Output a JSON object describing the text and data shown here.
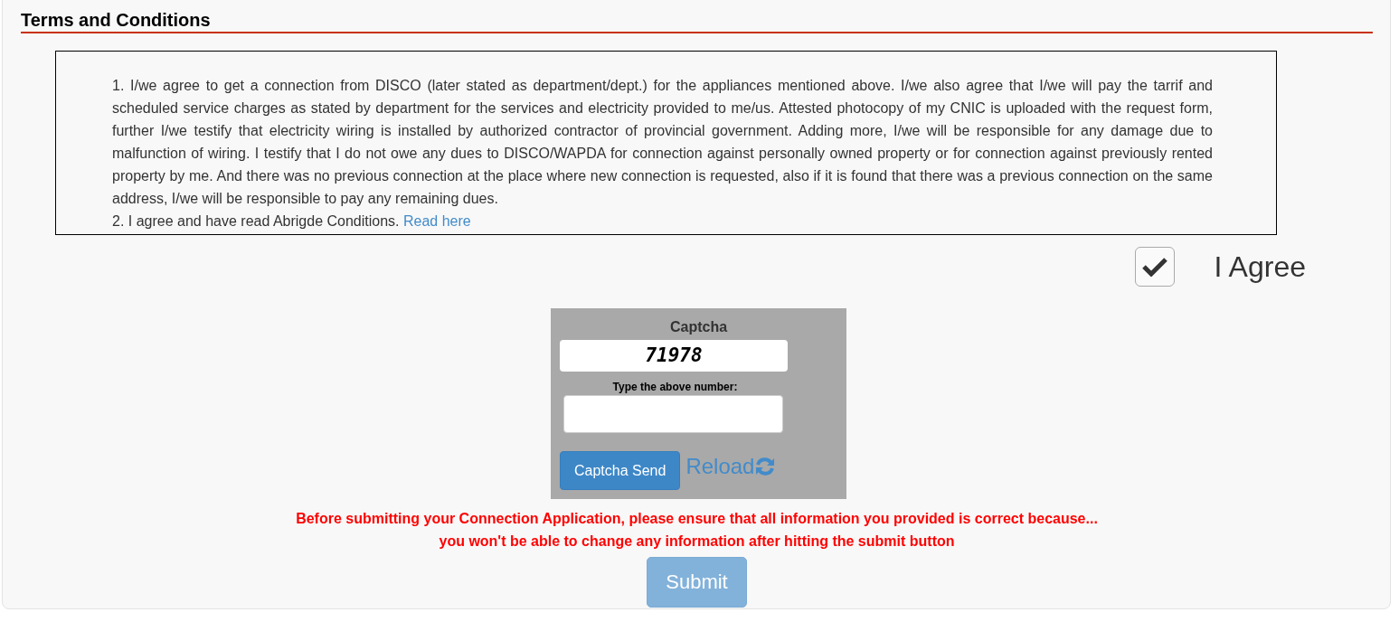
{
  "heading": "Terms and Conditions",
  "terms": [
    {
      "text": "1. I/we agree to get a connection from DISCO (later stated as department/dept.) for the appliances mentioned above. I/we also agree that I/we will pay the tarrif and scheduled service charges as stated by department for the services and electricity provided to me/us. Attested photocopy of my CNIC is uploaded with the request form, further I/we testify that electricity wiring is installed by authorized contractor of provincial government. Adding more, I/we will be responsible for any damage due to malfunction of wiring. I testify that I do not owe any dues to DISCO/WAPDA for connection against personally owned property or for connection against previously rented property by me. And there was no previous connection at the place where new connection is requested, also if it is found that there was a previous connection on the same address, I/we will be responsible to pay any remaining dues."
    },
    {
      "text": "2. I agree and have read Abrigde Conditions.",
      "link": "Read here"
    }
  ],
  "agree": {
    "label": "I Agree",
    "checked": true
  },
  "captcha": {
    "title": "Captcha",
    "code": "71978",
    "prompt": "Type the above number:",
    "send_button": "Captcha Send",
    "reload_link": "Reload"
  },
  "warning": [
    "Before submitting your Connection Application, please ensure that all information you provided is correct because...",
    "you won't be able to change any information after hitting the submit button"
  ],
  "submit": {
    "label": "Submit",
    "disabled": true
  }
}
